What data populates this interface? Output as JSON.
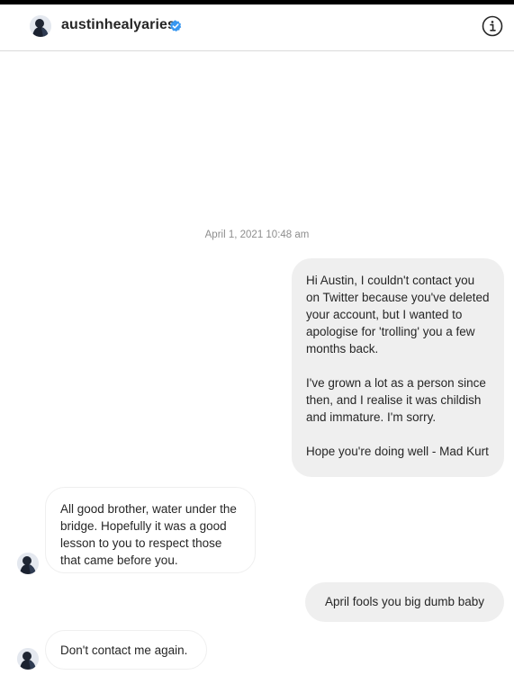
{
  "header": {
    "username": "austinhealyaries",
    "verified_icon": "verified-badge-icon",
    "info_icon": "info-icon"
  },
  "conversation": {
    "timestamp": "April 1, 2021 10:48 am",
    "messages": [
      {
        "direction": "sent",
        "paragraphs": [
          "Hi Austin, I couldn't contact you on Twitter because you've deleted your account, but I wanted to apologise for 'trolling' you a few months back.",
          "I've grown a lot as a person since then, and I realise it was childish and immature. I'm sorry.",
          "Hope you're doing well - Mad Kurt"
        ]
      },
      {
        "direction": "received",
        "paragraphs": [
          "All good brother, water under the bridge. Hopefully it was a good lesson to you to respect those that came before you."
        ]
      },
      {
        "direction": "sent",
        "paragraphs": [
          "April fools you big dumb baby"
        ]
      },
      {
        "direction": "received",
        "paragraphs": [
          "Don't contact me again."
        ]
      }
    ]
  },
  "colors": {
    "sent_bubble": "#efefef",
    "verified_blue": "#3897f0",
    "timestamp_gray": "#8e8e8e"
  }
}
